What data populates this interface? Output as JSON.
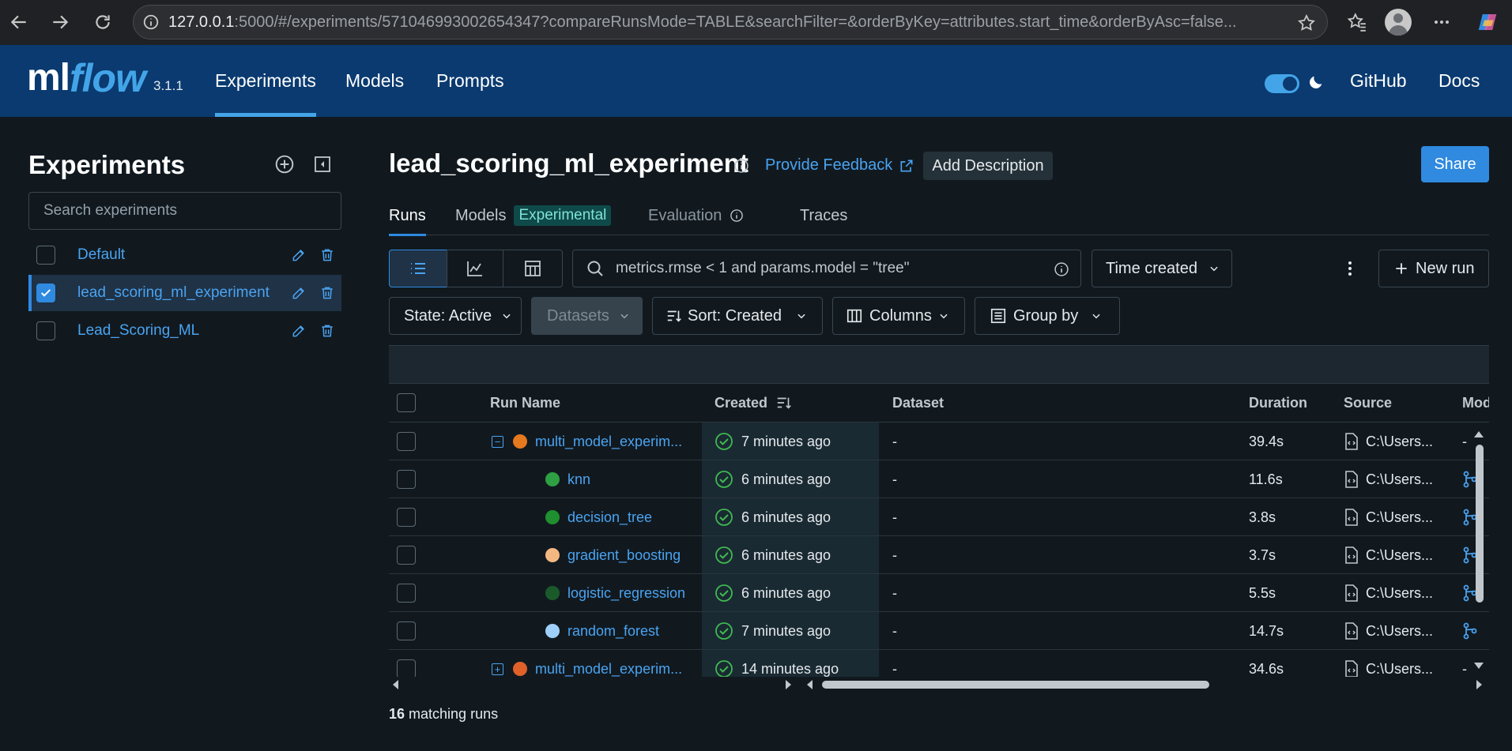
{
  "browser": {
    "url_host": "127.0.0.1",
    "url_rest": ":5000/#/experiments/571046993002654347?compareRunsMode=TABLE&searchFilter=&orderByKey=attributes.start_time&orderByAsc=false..."
  },
  "header": {
    "logo_ml": "ml",
    "logo_flow": "flow",
    "version": "3.1.1",
    "nav": [
      "Experiments",
      "Models",
      "Prompts"
    ],
    "github": "GitHub",
    "docs": "Docs"
  },
  "sidebar": {
    "title": "Experiments",
    "search_placeholder": "Search experiments",
    "experiments": [
      {
        "name": "Default",
        "selected": false
      },
      {
        "name": "lead_scoring_ml_experiment",
        "selected": true
      },
      {
        "name": "Lead_Scoring_ML",
        "selected": false
      }
    ]
  },
  "main": {
    "title": "lead_scoring_ml_experiment",
    "feedback": "Provide Feedback",
    "add_description": "Add Description",
    "share": "Share",
    "tabs": {
      "runs": "Runs",
      "models": "Models",
      "experimental": "Experimental",
      "evaluation": "Evaluation",
      "traces": "Traces"
    },
    "search_value": "metrics.rmse < 1 and params.model = \"tree\"",
    "time_created": "Time created",
    "new_run": "New run",
    "filters": {
      "state": "State: Active",
      "datasets": "Datasets",
      "sort": "Sort: Created",
      "columns": "Columns",
      "group_by": "Group by"
    }
  },
  "table": {
    "headers": {
      "run_name": "Run Name",
      "created": "Created",
      "dataset": "Dataset",
      "duration": "Duration",
      "source": "Source",
      "models": "Mod"
    },
    "rows": [
      {
        "name": "multi_model_experim...",
        "level": 0,
        "expander": "−",
        "dot": "#e6781e",
        "created": "7 minutes ago",
        "dataset": "-",
        "duration": "39.4s",
        "source": "C:\\Users...",
        "model": "-"
      },
      {
        "name": "knn",
        "level": 1,
        "dot": "#2ea043",
        "created": "6 minutes ago",
        "dataset": "-",
        "duration": "11.6s",
        "source": "C:\\Users...",
        "model": "icon"
      },
      {
        "name": "decision_tree",
        "level": 1,
        "dot": "#1f8f2f",
        "created": "6 minutes ago",
        "dataset": "-",
        "duration": "3.8s",
        "source": "C:\\Users...",
        "model": "icon"
      },
      {
        "name": "gradient_boosting",
        "level": 1,
        "dot": "#f3b882",
        "created": "6 minutes ago",
        "dataset": "-",
        "duration": "3.7s",
        "source": "C:\\Users...",
        "model": "icon"
      },
      {
        "name": "logistic_regression",
        "level": 1,
        "dot": "#1a5a2a",
        "created": "6 minutes ago",
        "dataset": "-",
        "duration": "5.5s",
        "source": "C:\\Users...",
        "model": "icon"
      },
      {
        "name": "random_forest",
        "level": 1,
        "dot": "#9fd0fa",
        "created": "7 minutes ago",
        "dataset": "-",
        "duration": "14.7s",
        "source": "C:\\Users...",
        "model": "icon"
      },
      {
        "name": "multi_model_experim...",
        "level": 0,
        "expander": "+",
        "dot": "#e0612a",
        "created": "14 minutes ago",
        "dataset": "-",
        "duration": "34.6s",
        "source": "C:\\Users...",
        "model": "-"
      }
    ]
  },
  "footer": {
    "count": "16",
    "label": " matching runs"
  },
  "colors": {
    "accent": "#2f8ae0",
    "header_bg": "#0a3a70",
    "page_bg": "#11191f",
    "success": "#3fb950"
  }
}
